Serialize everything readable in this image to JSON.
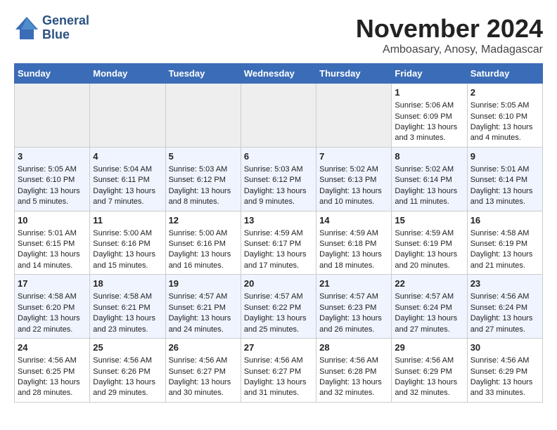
{
  "header": {
    "logo_line1": "General",
    "logo_line2": "Blue",
    "title": "November 2024",
    "subtitle": "Amboasary, Anosy, Madagascar"
  },
  "columns": [
    "Sunday",
    "Monday",
    "Tuesday",
    "Wednesday",
    "Thursday",
    "Friday",
    "Saturday"
  ],
  "weeks": [
    [
      {
        "day": "",
        "info": ""
      },
      {
        "day": "",
        "info": ""
      },
      {
        "day": "",
        "info": ""
      },
      {
        "day": "",
        "info": ""
      },
      {
        "day": "",
        "info": ""
      },
      {
        "day": "1",
        "info": "Sunrise: 5:06 AM\nSunset: 6:09 PM\nDaylight: 13 hours and 3 minutes."
      },
      {
        "day": "2",
        "info": "Sunrise: 5:05 AM\nSunset: 6:10 PM\nDaylight: 13 hours and 4 minutes."
      }
    ],
    [
      {
        "day": "3",
        "info": "Sunrise: 5:05 AM\nSunset: 6:10 PM\nDaylight: 13 hours and 5 minutes."
      },
      {
        "day": "4",
        "info": "Sunrise: 5:04 AM\nSunset: 6:11 PM\nDaylight: 13 hours and 7 minutes."
      },
      {
        "day": "5",
        "info": "Sunrise: 5:03 AM\nSunset: 6:12 PM\nDaylight: 13 hours and 8 minutes."
      },
      {
        "day": "6",
        "info": "Sunrise: 5:03 AM\nSunset: 6:12 PM\nDaylight: 13 hours and 9 minutes."
      },
      {
        "day": "7",
        "info": "Sunrise: 5:02 AM\nSunset: 6:13 PM\nDaylight: 13 hours and 10 minutes."
      },
      {
        "day": "8",
        "info": "Sunrise: 5:02 AM\nSunset: 6:14 PM\nDaylight: 13 hours and 11 minutes."
      },
      {
        "day": "9",
        "info": "Sunrise: 5:01 AM\nSunset: 6:14 PM\nDaylight: 13 hours and 13 minutes."
      }
    ],
    [
      {
        "day": "10",
        "info": "Sunrise: 5:01 AM\nSunset: 6:15 PM\nDaylight: 13 hours and 14 minutes."
      },
      {
        "day": "11",
        "info": "Sunrise: 5:00 AM\nSunset: 6:16 PM\nDaylight: 13 hours and 15 minutes."
      },
      {
        "day": "12",
        "info": "Sunrise: 5:00 AM\nSunset: 6:16 PM\nDaylight: 13 hours and 16 minutes."
      },
      {
        "day": "13",
        "info": "Sunrise: 4:59 AM\nSunset: 6:17 PM\nDaylight: 13 hours and 17 minutes."
      },
      {
        "day": "14",
        "info": "Sunrise: 4:59 AM\nSunset: 6:18 PM\nDaylight: 13 hours and 18 minutes."
      },
      {
        "day": "15",
        "info": "Sunrise: 4:59 AM\nSunset: 6:19 PM\nDaylight: 13 hours and 20 minutes."
      },
      {
        "day": "16",
        "info": "Sunrise: 4:58 AM\nSunset: 6:19 PM\nDaylight: 13 hours and 21 minutes."
      }
    ],
    [
      {
        "day": "17",
        "info": "Sunrise: 4:58 AM\nSunset: 6:20 PM\nDaylight: 13 hours and 22 minutes."
      },
      {
        "day": "18",
        "info": "Sunrise: 4:58 AM\nSunset: 6:21 PM\nDaylight: 13 hours and 23 minutes."
      },
      {
        "day": "19",
        "info": "Sunrise: 4:57 AM\nSunset: 6:21 PM\nDaylight: 13 hours and 24 minutes."
      },
      {
        "day": "20",
        "info": "Sunrise: 4:57 AM\nSunset: 6:22 PM\nDaylight: 13 hours and 25 minutes."
      },
      {
        "day": "21",
        "info": "Sunrise: 4:57 AM\nSunset: 6:23 PM\nDaylight: 13 hours and 26 minutes."
      },
      {
        "day": "22",
        "info": "Sunrise: 4:57 AM\nSunset: 6:24 PM\nDaylight: 13 hours and 27 minutes."
      },
      {
        "day": "23",
        "info": "Sunrise: 4:56 AM\nSunset: 6:24 PM\nDaylight: 13 hours and 27 minutes."
      }
    ],
    [
      {
        "day": "24",
        "info": "Sunrise: 4:56 AM\nSunset: 6:25 PM\nDaylight: 13 hours and 28 minutes."
      },
      {
        "day": "25",
        "info": "Sunrise: 4:56 AM\nSunset: 6:26 PM\nDaylight: 13 hours and 29 minutes."
      },
      {
        "day": "26",
        "info": "Sunrise: 4:56 AM\nSunset: 6:27 PM\nDaylight: 13 hours and 30 minutes."
      },
      {
        "day": "27",
        "info": "Sunrise: 4:56 AM\nSunset: 6:27 PM\nDaylight: 13 hours and 31 minutes."
      },
      {
        "day": "28",
        "info": "Sunrise: 4:56 AM\nSunset: 6:28 PM\nDaylight: 13 hours and 32 minutes."
      },
      {
        "day": "29",
        "info": "Sunrise: 4:56 AM\nSunset: 6:29 PM\nDaylight: 13 hours and 32 minutes."
      },
      {
        "day": "30",
        "info": "Sunrise: 4:56 AM\nSunset: 6:29 PM\nDaylight: 13 hours and 33 minutes."
      }
    ]
  ]
}
